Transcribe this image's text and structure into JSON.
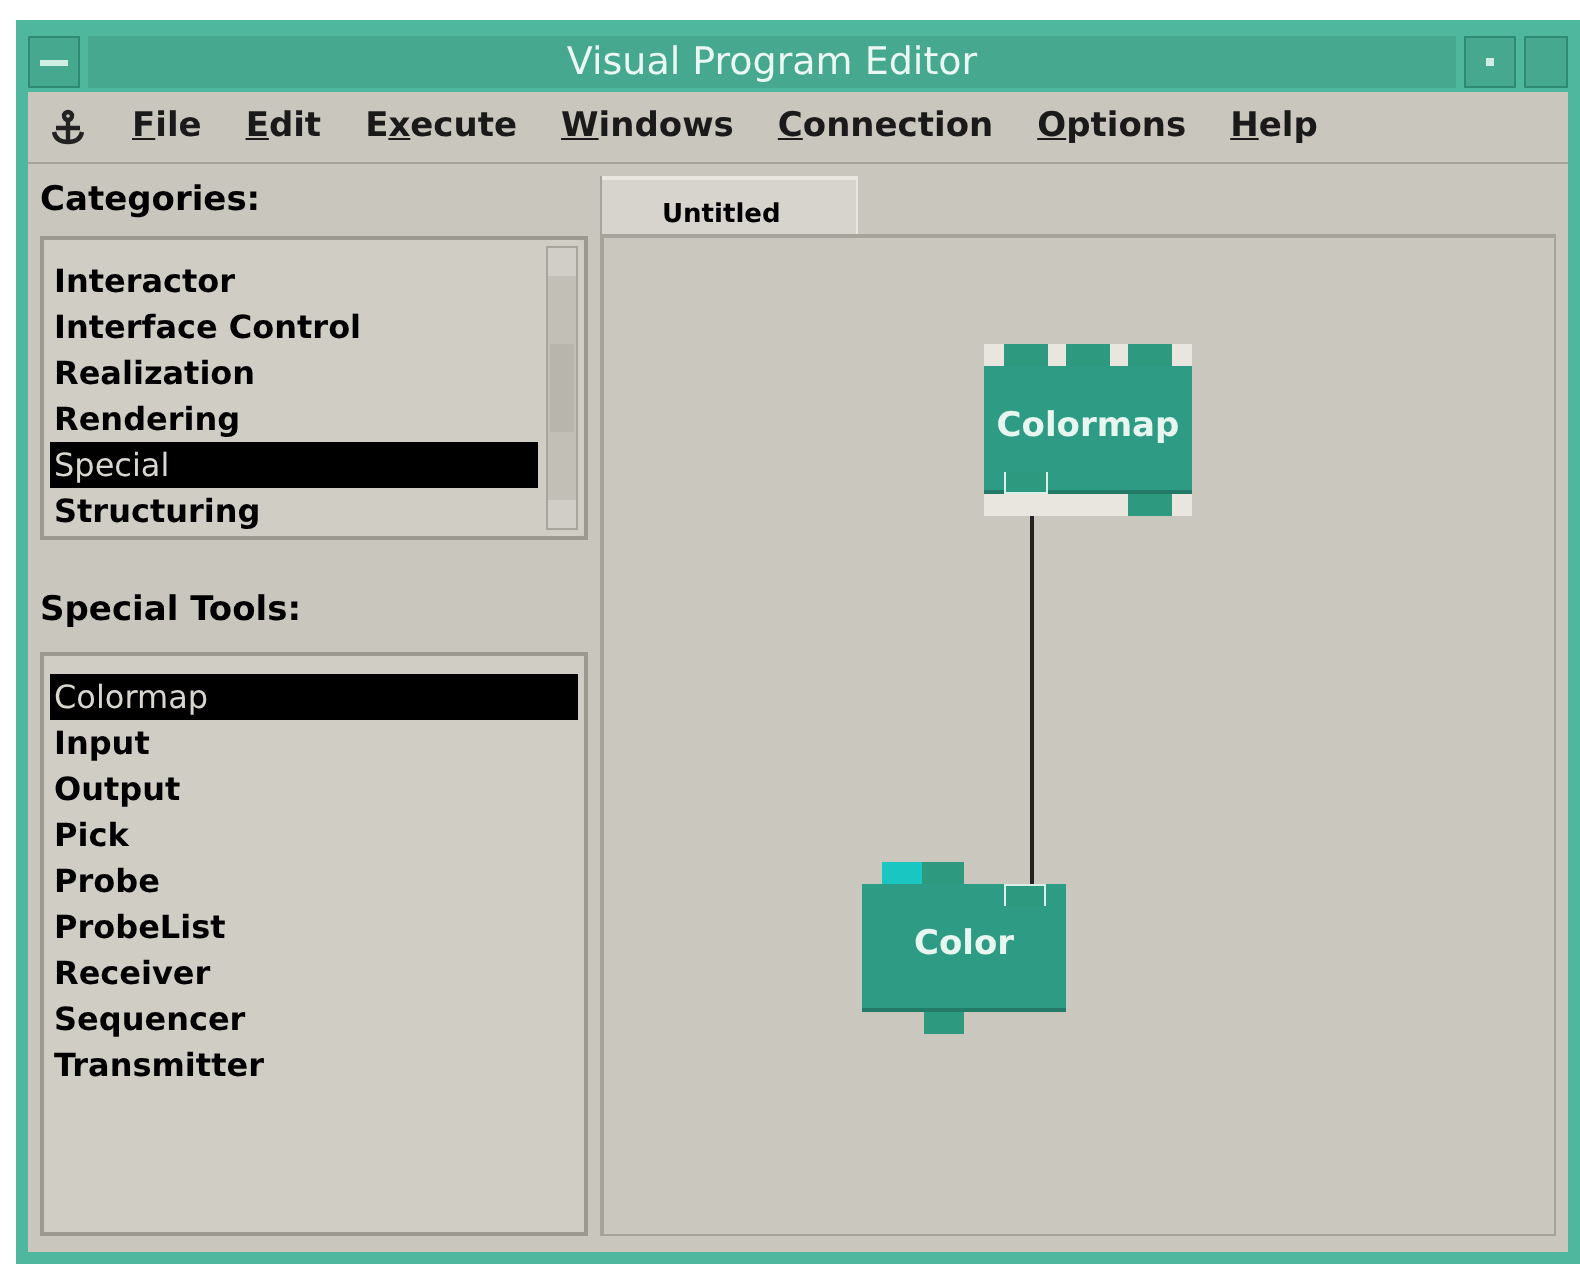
{
  "window": {
    "title": "Visual Program Editor"
  },
  "menu": [
    {
      "parts": [
        {
          "text": "F",
          "underlined": true
        },
        {
          "text": "ile",
          "underlined": false
        }
      ]
    },
    {
      "parts": [
        {
          "text": "E",
          "underlined": true
        },
        {
          "text": "dit",
          "underlined": false
        }
      ]
    },
    {
      "parts": [
        {
          "text": "E",
          "underlined": false
        },
        {
          "text": "x",
          "underlined": true
        },
        {
          "text": "ecute",
          "underlined": false
        }
      ]
    },
    {
      "parts": [
        {
          "text": "W",
          "underlined": true
        },
        {
          "text": "indows",
          "underlined": false
        }
      ]
    },
    {
      "parts": [
        {
          "text": "C",
          "underlined": true
        },
        {
          "text": "onnection",
          "underlined": false
        }
      ]
    },
    {
      "parts": [
        {
          "text": "O",
          "underlined": true
        },
        {
          "text": "ptions",
          "underlined": false
        }
      ]
    },
    {
      "parts": [
        {
          "text": "H",
          "underlined": true
        },
        {
          "text": "elp",
          "underlined": false
        }
      ]
    }
  ],
  "categories": {
    "label": "Categories:",
    "items": [
      {
        "label": "Interactor",
        "selected": false
      },
      {
        "label": "Interface Control",
        "selected": false
      },
      {
        "label": "Realization",
        "selected": false
      },
      {
        "label": "Rendering",
        "selected": false
      },
      {
        "label": "Special",
        "selected": true
      },
      {
        "label": "Structuring",
        "selected": false
      }
    ]
  },
  "tools": {
    "label": "Special Tools:",
    "items": [
      {
        "label": "Colormap",
        "selected": true
      },
      {
        "label": "Input",
        "selected": false
      },
      {
        "label": "Output",
        "selected": false
      },
      {
        "label": "Pick",
        "selected": false
      },
      {
        "label": "Probe",
        "selected": false
      },
      {
        "label": "ProbeList",
        "selected": false
      },
      {
        "label": "Receiver",
        "selected": false
      },
      {
        "label": "Sequencer",
        "selected": false
      },
      {
        "label": "Transmitter",
        "selected": false
      }
    ]
  },
  "tabs": [
    {
      "label": "Untitled",
      "selected": true
    }
  ],
  "nodes": [
    {
      "label": "Colormap",
      "inputs": [
        {
          "kind": "port"
        },
        {
          "kind": "port"
        },
        {
          "kind": "port"
        }
      ],
      "outputs": [
        {
          "kind": "connected"
        },
        {
          "kind": "gap"
        },
        {
          "kind": "port"
        }
      ]
    },
    {
      "label": "Color",
      "inputs": [
        {
          "kind": "highlighted"
        },
        {
          "kind": "port"
        },
        {
          "kind": "gap"
        },
        {
          "kind": "connected"
        }
      ],
      "outputs": [
        {
          "kind": "gap"
        },
        {
          "kind": "port"
        },
        {
          "kind": "gap"
        },
        {
          "kind": "gap"
        }
      ]
    }
  ]
}
